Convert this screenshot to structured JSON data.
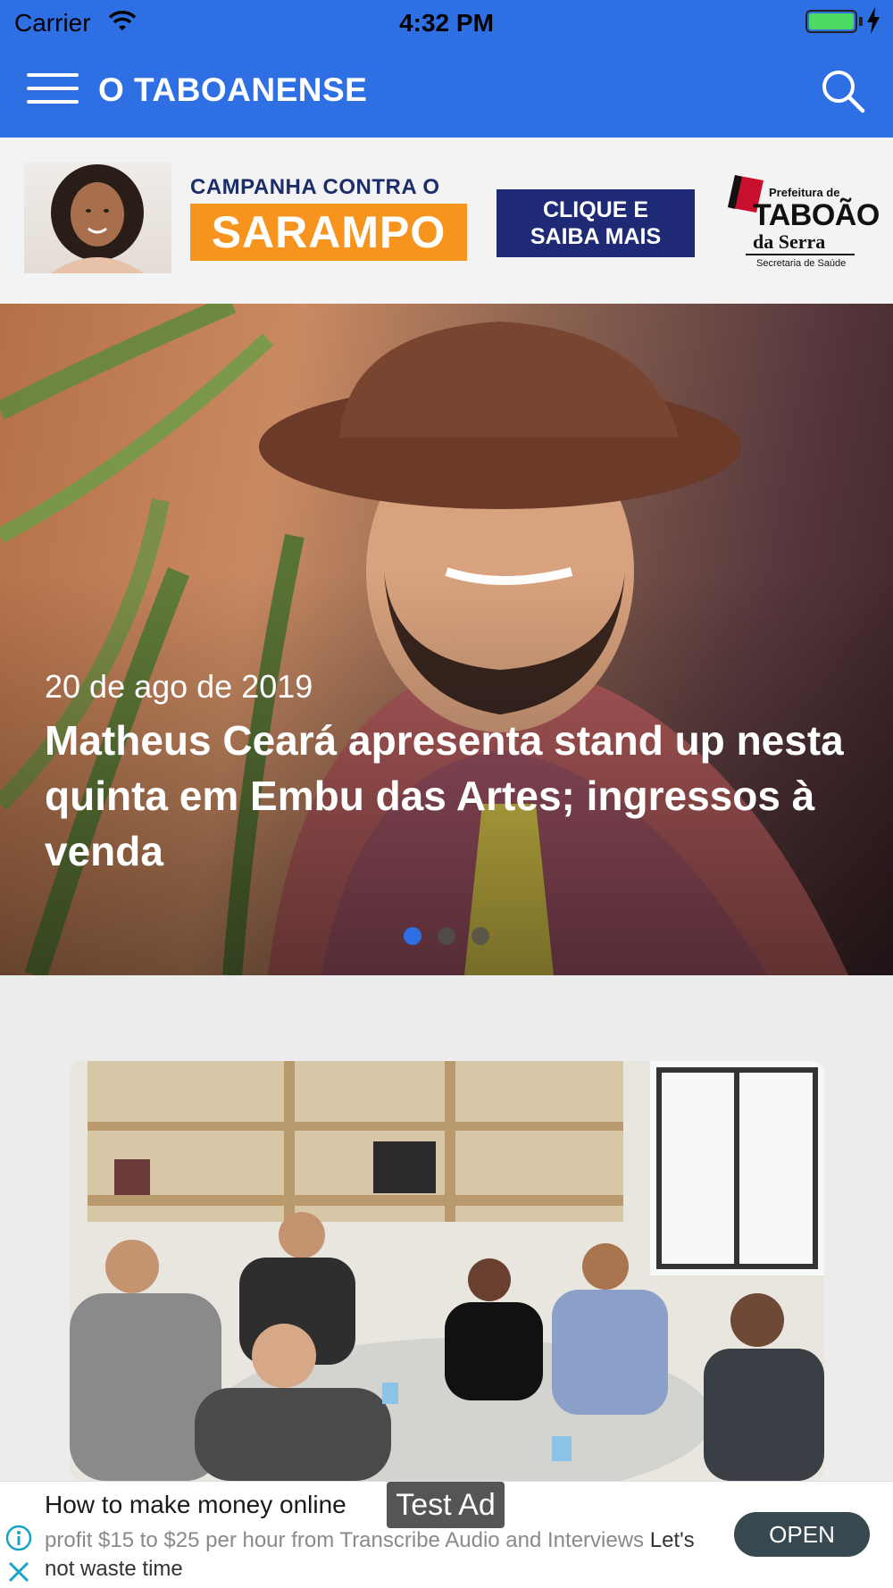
{
  "status_bar": {
    "carrier": "Carrier",
    "time": "4:32 PM"
  },
  "nav": {
    "title": "O TABOANENSE"
  },
  "banner": {
    "campaign_line": "CAMPANHA CONTRA O",
    "campaign_word": "SARAMPO",
    "cta_line1": "CLIQUE E",
    "cta_line2": "SAIBA MAIS",
    "pref_line1": "Prefeitura de",
    "pref_line2": "TABOÃO",
    "pref_line3": "da Serra",
    "pref_line4": "Secretaria de Saúde"
  },
  "hero": {
    "date": "20 de ago de 2019",
    "title": "Matheus Ceará apresenta stand up nesta quinta em Embu das Artes; ingressos à venda",
    "slide_count": 3,
    "active_slide": 1
  },
  "bottom_ad": {
    "title": "How to make money online",
    "tag": "Test Ad",
    "body": "profit $15 to $25 per hour from Transcribe Audio and Interviews",
    "body_highlight": "Let's not waste time",
    "open_label": "OPEN"
  },
  "colors": {
    "primary": "#2f6fe4",
    "orange": "#f7941d",
    "navy": "#1f2a76",
    "ad_button": "#374850"
  }
}
